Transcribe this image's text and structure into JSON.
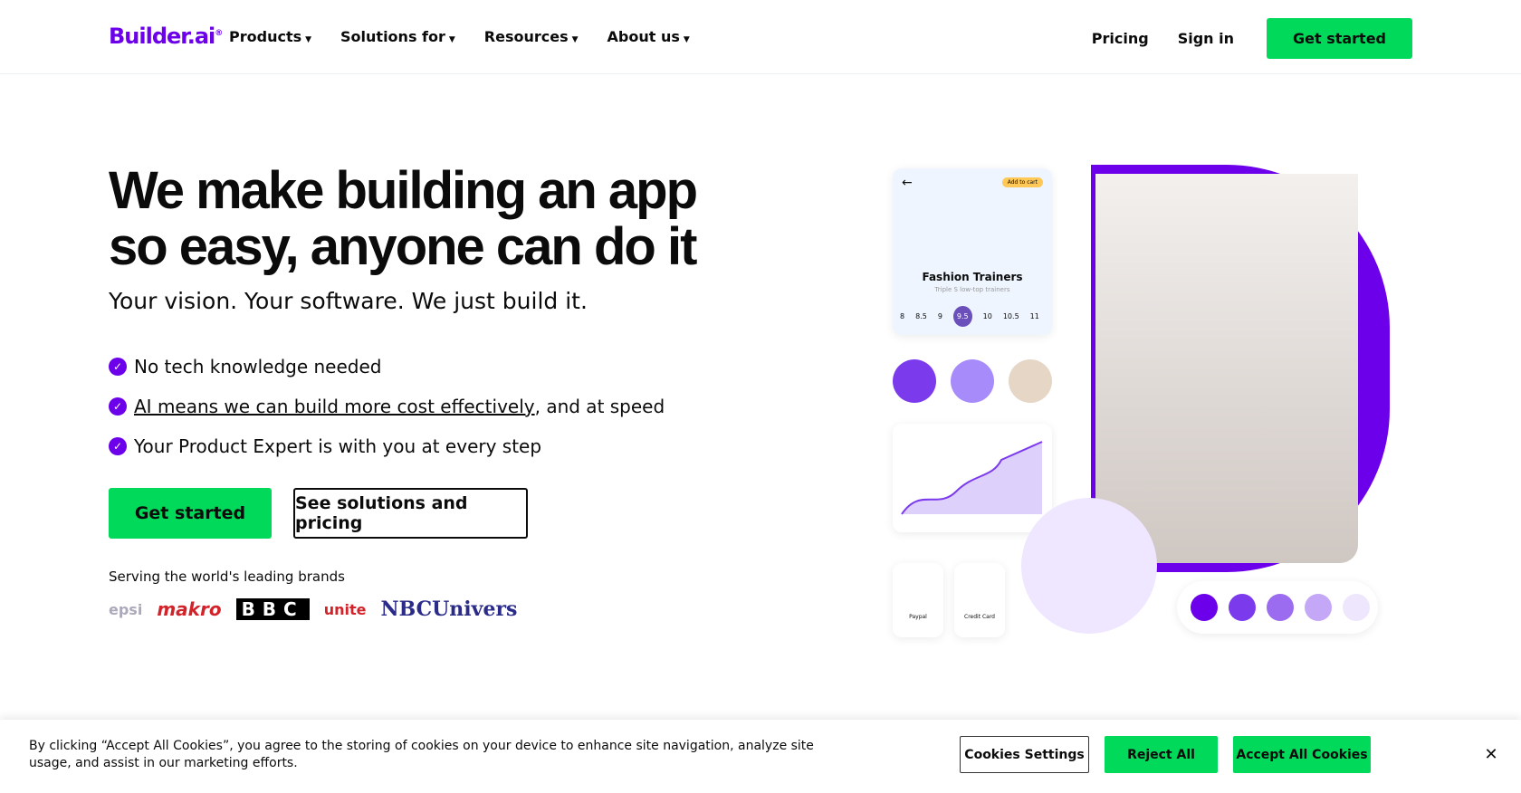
{
  "nav": {
    "logo": "Builder.ai",
    "menu": [
      "Products",
      "Solutions for",
      "Resources",
      "About us"
    ],
    "pricing": "Pricing",
    "signin": "Sign in",
    "cta": "Get started"
  },
  "hero": {
    "title": "We make building an app so easy, anyone can do it",
    "subtitle": "Your vision. Your software. We just build it.",
    "points": [
      {
        "link": "",
        "text": "No tech knowledge needed"
      },
      {
        "link": "AI means we can build more cost effectively",
        "text": ", and at speed"
      },
      {
        "link": "",
        "text": "Your Product Expert is with you at every step"
      }
    ],
    "cta_primary": "Get started",
    "cta_secondary": "See solutions and pricing",
    "brands_label": "Serving the world's leading brands",
    "brands": [
      "epsi",
      "makro",
      "BBC",
      "unite",
      "NBCUnivers"
    ]
  },
  "illustration": {
    "product": "Fashion Trainers",
    "product_sub": "Triple S low-top trainers",
    "add_to_cart": "Add to cart",
    "sizes": [
      "8",
      "8.5",
      "9",
      "9.5",
      "10",
      "10.5",
      "11"
    ],
    "selected_size": "9.5",
    "pay1": "Paypal",
    "pay2": "Credit Card"
  },
  "cookie": {
    "text": "By clicking “Accept All Cookies”, you agree to the storing of cookies on your device to enhance site navigation, analyze site usage, and assist in our marketing efforts.",
    "settings": "Cookies Settings",
    "reject": "Reject All",
    "accept": "Accept All Cookies",
    "close": "✕"
  },
  "colors": {
    "brand": "#6c00ea",
    "green": "#00d95a"
  }
}
